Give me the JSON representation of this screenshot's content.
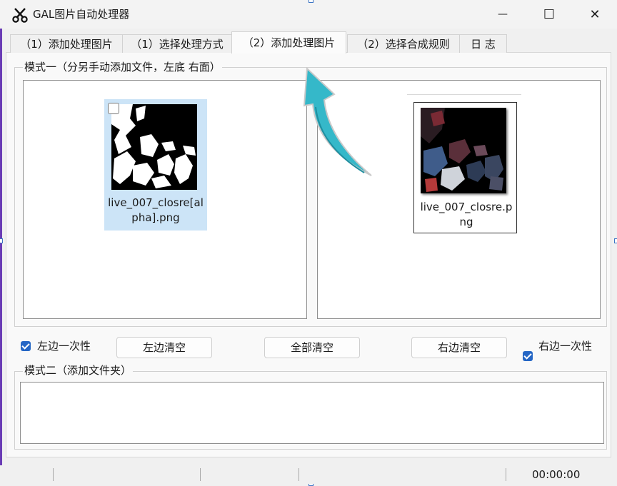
{
  "window": {
    "title": "GAL图片自动处理器",
    "minimize_glyph": "—",
    "maximize_glyph": "☐",
    "close_glyph": "✕"
  },
  "tabs": [
    {
      "label": "（1）添加处理图片",
      "active": false
    },
    {
      "label": "（1）选择处理方式",
      "active": false
    },
    {
      "label": "（2）添加处理图片",
      "active": true
    },
    {
      "label": "（2）选择合成规则",
      "active": false
    },
    {
      "label": "日 志",
      "active": false
    }
  ],
  "mode1": {
    "label": "模式一（分另手动添加文件，左底 右面）",
    "left_file": "live_007_closre[alpha].png",
    "right_file": "live_007_closre.png"
  },
  "controls": {
    "left_once_label": "左边一次性",
    "left_clear_label": "左边清空",
    "clear_all_label": "全部清空",
    "right_clear_label": "右边清空",
    "right_once_label": "右边一次性"
  },
  "mode2": {
    "label": "模式二（添加文件夹）"
  },
  "status": {
    "time": "00:00:00"
  },
  "colors": {
    "accent": "#2466c5",
    "selection": "#cce4f7",
    "arrow": "#35b8c9"
  },
  "icons": [
    "scissors-icon",
    "minimize-icon",
    "maximize-icon",
    "close-icon",
    "checkbox-icon",
    "arrow-icon"
  ]
}
